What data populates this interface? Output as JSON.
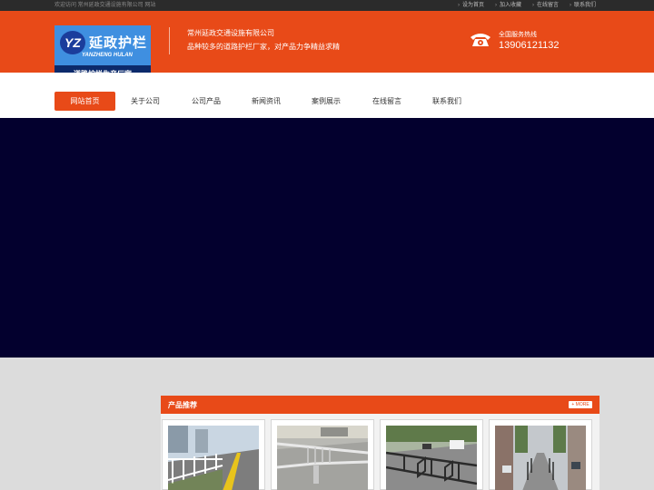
{
  "topbar": {
    "welcome": "欢迎访问 常州延政交通设施有限公司 网站",
    "links": [
      "设为首页",
      "加入收藏",
      "在线留言",
      "联系我们"
    ]
  },
  "logo": {
    "mark": "YZ",
    "name_cn": "延政护栏",
    "name_en": "YANZHENG HULAN",
    "slogan": "--道路护栏生产厂家--"
  },
  "header": {
    "company": "常州延政交通设施有限公司",
    "tagline": "品种较多的道路护栏厂家，对产品力争精益求精",
    "hotline_label": "全国服务热线",
    "hotline_number": "13906121132"
  },
  "nav": {
    "items": [
      "网站首页",
      "关于公司",
      "公司产品",
      "新闻资讯",
      "案例展示",
      "在线留言",
      "联系我们"
    ],
    "active": "网站首页"
  },
  "products": {
    "title": "产品推荐",
    "more": "+ MORE"
  },
  "colors": {
    "brand_orange": "#e84a18",
    "banner_navy": "#03002e",
    "topbar_dark": "#2b2b2b"
  },
  "icons": [
    "phone-icon"
  ]
}
